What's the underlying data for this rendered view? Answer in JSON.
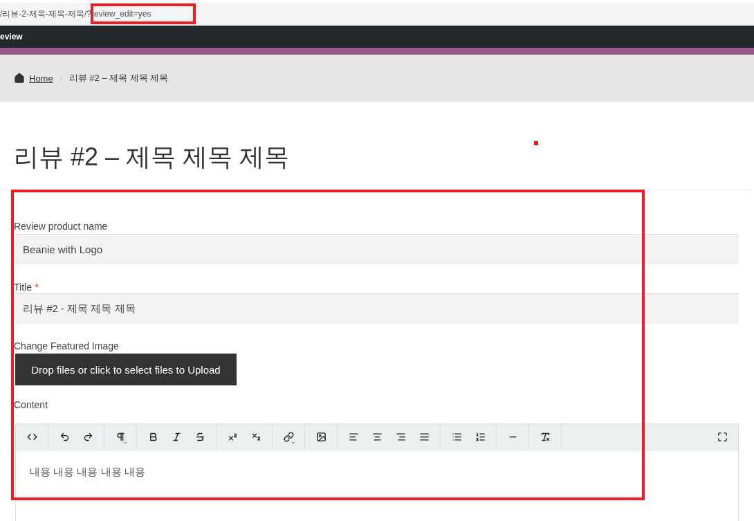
{
  "address_bar": {
    "url": "/리뷰-2-제목-제목-제목/?review_edit=yes"
  },
  "top_bar": {
    "title": "eview"
  },
  "breadcrumb": {
    "items": [
      {
        "label": "Home",
        "kind": "link"
      },
      {
        "label": "리뷰 #2 – 제목 제목 제목",
        "kind": "current"
      }
    ]
  },
  "page_title": "리뷰 #2 – 제목 제목 제목",
  "form": {
    "fields": [
      {
        "label": "Review product name",
        "value": "Beanie with Logo"
      },
      {
        "label": "Title",
        "required_mark": "*",
        "value": "리뷰 #2 - 제목 제목 제목"
      }
    ],
    "image": {
      "label": "Change Featured Image",
      "button": "Drop files or click to select files to Upload"
    },
    "content": {
      "label": "Content",
      "text": "내용 내용 내용 내용 내용"
    }
  }
}
